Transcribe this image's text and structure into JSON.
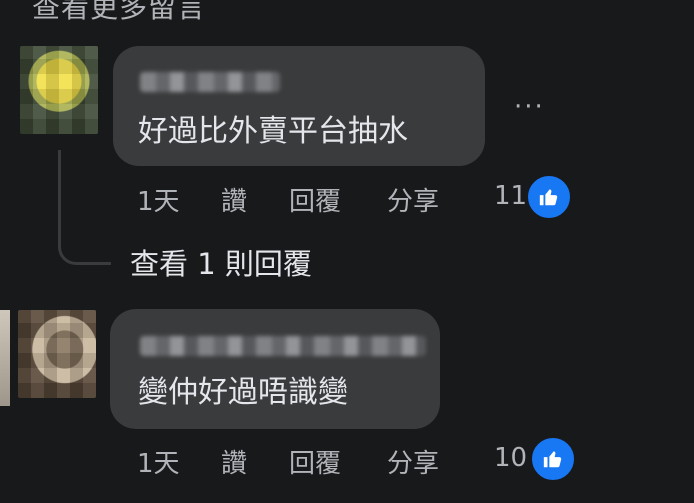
{
  "header": {
    "view_more_comments": "查看更多留言"
  },
  "comments": [
    {
      "text": "好過比外賣平台抽水",
      "actions": {
        "time": "1天",
        "like": "讚",
        "reply": "回覆",
        "share": "分享"
      },
      "reactions": "11",
      "view_replies": "查看 1 則回覆"
    },
    {
      "text": "變仲好過唔識變",
      "actions": {
        "time": "1天",
        "like": "讚",
        "reply": "回覆",
        "share": "分享"
      },
      "reactions": "10"
    }
  ],
  "colors": {
    "background": "#18191a",
    "bubble": "#3a3b3c",
    "like_blue": "#1877f2",
    "secondary_text": "#b0b3b8"
  },
  "icons": [
    "thumbs-up-icon",
    "more-options-icon"
  ]
}
